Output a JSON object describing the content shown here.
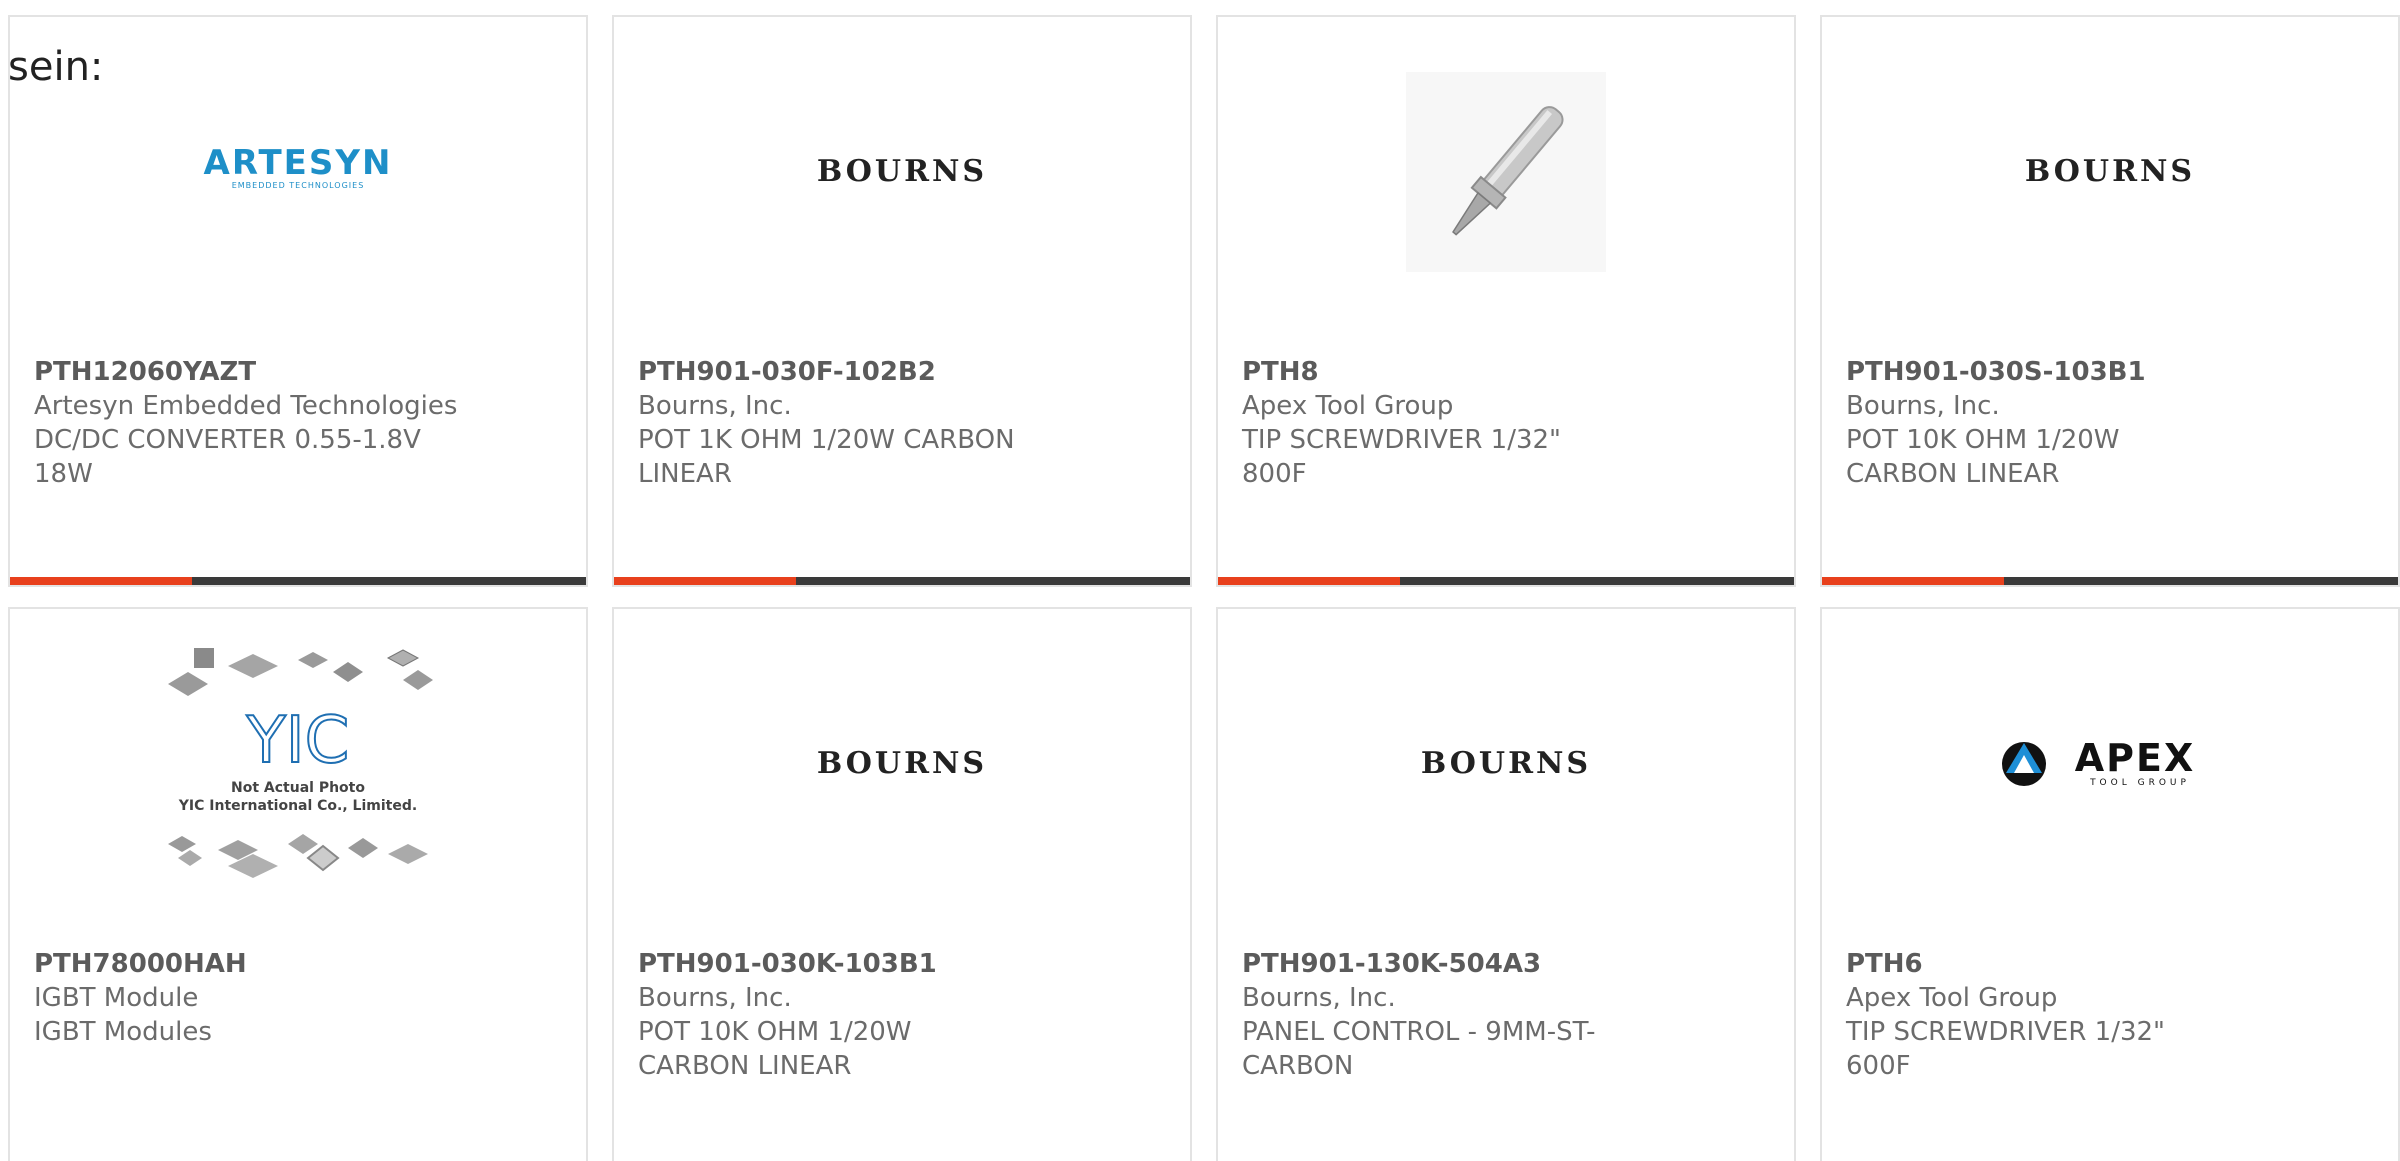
{
  "page": {
    "label": "sein:"
  },
  "colors": {
    "accent": "#e8401c",
    "bar_dark": "#3a3a3a",
    "text": "#6b6b6b",
    "border": "#e3e3e3"
  },
  "cards": [
    {
      "part_number": "PTH12060YAZT",
      "manufacturer": "Artesyn Embedded Technologies",
      "description": "DC/DC CONVERTER 0.55-1.8V 18W",
      "logo_text": "ARTESYN",
      "logo_subtext": "EMBEDDED TECHNOLOGIES",
      "image_type": "artesyn-logo"
    },
    {
      "part_number": "PTH901-030F-102B2",
      "manufacturer": "Bourns, Inc.",
      "description": "POT 1K OHM 1/20W CARBON LINEAR",
      "logo_text": "BOURNS",
      "image_type": "bourns-logo"
    },
    {
      "part_number": "PTH8",
      "manufacturer": "Apex Tool Group",
      "description": "TIP SCREWDRIVER 1/32\" 800F",
      "image_type": "soldering-tip-photo"
    },
    {
      "part_number": "PTH901-030S-103B1",
      "manufacturer": "Bourns, Inc.",
      "description": "POT 10K OHM 1/20W CARBON LINEAR",
      "logo_text": "BOURNS",
      "image_type": "bourns-logo"
    },
    {
      "part_number": "PTH78000HAH",
      "manufacturer": "IGBT Module",
      "description": "IGBT Modules",
      "placeholder_line1": "Not Actual Photo",
      "placeholder_line2": "YIC International Co., Limited.",
      "image_type": "yic-placeholder"
    },
    {
      "part_number": "PTH901-030K-103B1",
      "manufacturer": "Bourns, Inc.",
      "description": "POT 10K OHM 1/20W CARBON LINEAR",
      "logo_text": "BOURNS",
      "image_type": "bourns-logo"
    },
    {
      "part_number": "PTH901-130K-504A3",
      "manufacturer": "Bourns, Inc.",
      "description": "PANEL CONTROL - 9MM-ST-CARBON",
      "logo_text": "BOURNS",
      "image_type": "bourns-logo"
    },
    {
      "part_number": "PTH6",
      "manufacturer": "Apex Tool Group",
      "description": "TIP SCREWDRIVER 1/32\" 600F",
      "logo_text": "APEX",
      "logo_subtext": "TOOL GROUP",
      "image_type": "apex-logo"
    }
  ]
}
